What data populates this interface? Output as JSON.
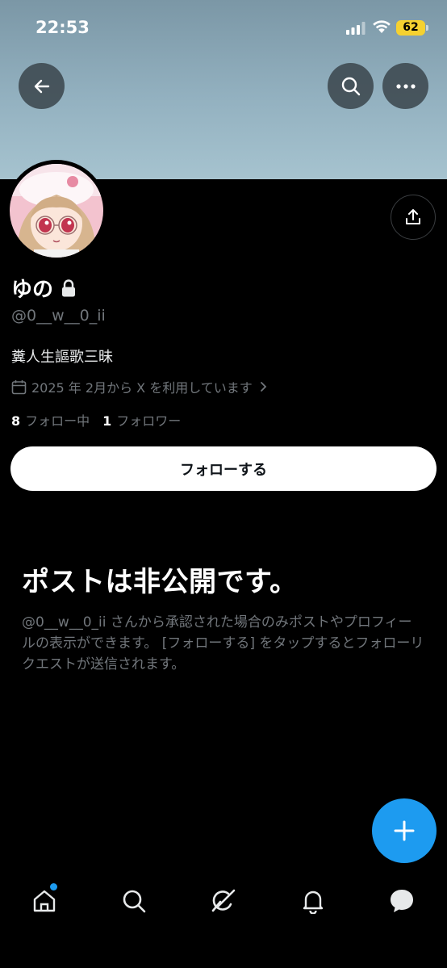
{
  "status_bar": {
    "time": "22:53",
    "battery": "62",
    "battery_color": "#f5d130"
  },
  "header": {
    "back_icon": "arrow-left-icon",
    "search_icon": "search-icon",
    "more_icon": "more-horizontal-icon",
    "share_icon": "share-upload-icon"
  },
  "profile": {
    "display_name": "ゆの",
    "handle": "@0__w__0_ii",
    "bio": "糞人生謳歌三昧",
    "joined": "2025 年 2月から X を利用しています",
    "following_count": "8",
    "following_label": "フォロー中",
    "followers_count": "1",
    "followers_label": "フォロワー",
    "follow_button_label": "フォローする"
  },
  "private_notice": {
    "title": "ポストは非公開です。",
    "description": "@0__w__0_ii さんから承認された場合のみポストやプロフィールの表示ができます。 [フォローする] をタップするとフォローリクエストが送信されます。"
  },
  "colors": {
    "accent": "#1d9bf0",
    "background": "#000000",
    "secondary_text": "#71767b"
  },
  "bottom_nav": {
    "items": [
      "home-icon",
      "search-icon",
      "grok-icon",
      "notifications-bell-icon",
      "messages-icon"
    ]
  }
}
